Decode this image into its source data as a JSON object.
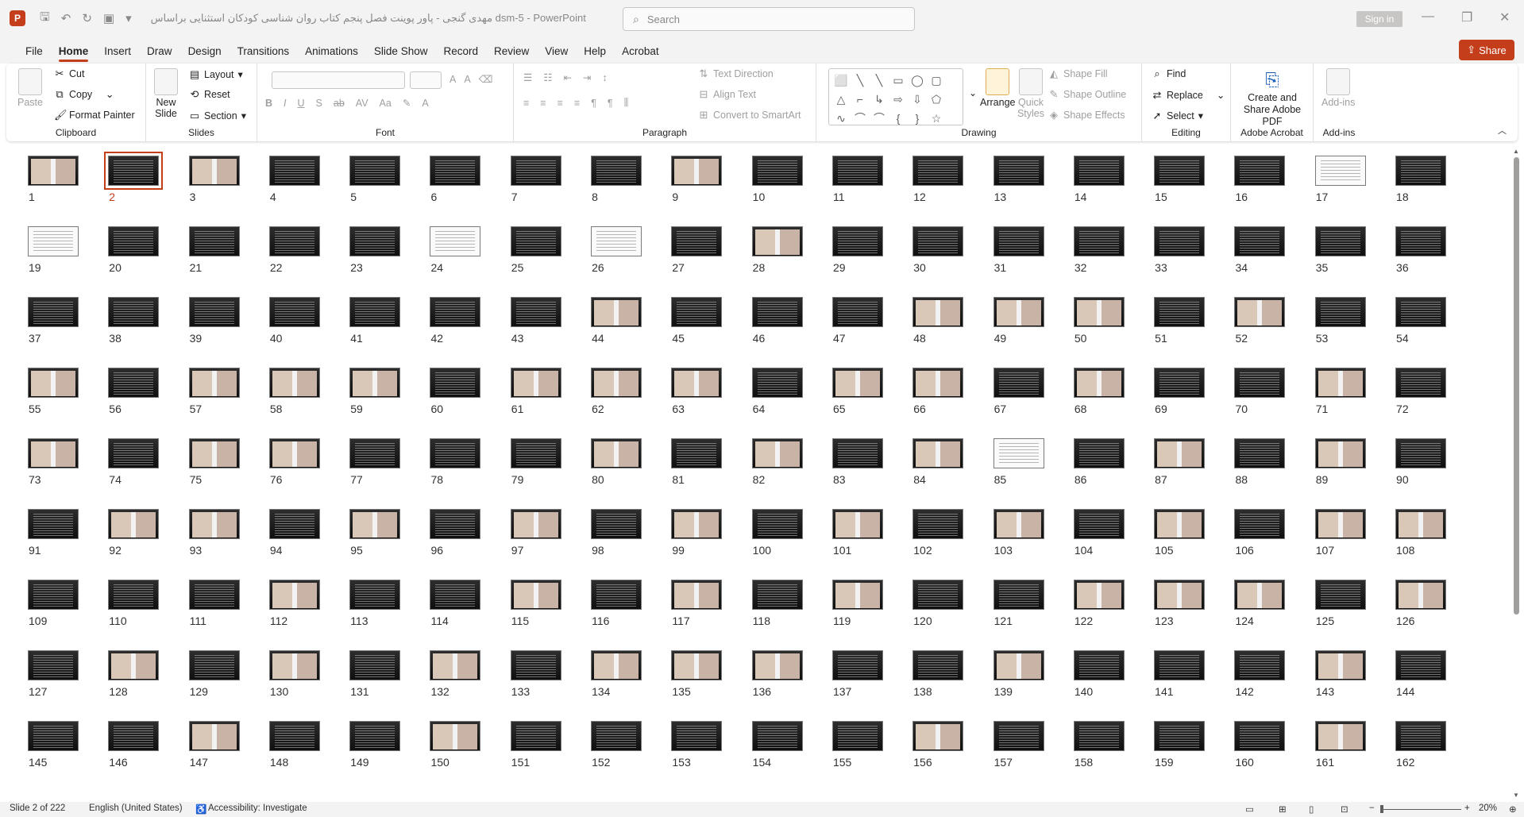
{
  "window": {
    "app_badge": "P",
    "title": "مهدی گنجی - پاور پوینت فصل پنجم کتاب روان شناسی کودکان استثنایی براساس dsm-5 - PowerPoint",
    "search_placeholder": "Search",
    "sign_in": "Sign in",
    "minimize": "—",
    "restore": "❐",
    "close": "✕"
  },
  "quick_access": {
    "save": "💾",
    "undo": "↶",
    "redo": "↷",
    "present": "▣",
    "customize": "⌄"
  },
  "menu": {
    "tabs": [
      "File",
      "Home",
      "Insert",
      "Draw",
      "Design",
      "Transitions",
      "Animations",
      "Slide Show",
      "Record",
      "Review",
      "View",
      "Help",
      "Acrobat"
    ],
    "active": "Home",
    "share": "Share"
  },
  "ribbon": {
    "clipboard": {
      "label": "Clipboard",
      "paste": "Paste",
      "cut": "Cut",
      "copy": "Copy",
      "format_painter": "Format Painter"
    },
    "slides": {
      "label": "Slides",
      "new_slide": "New Slide",
      "layout": "Layout",
      "reset": "Reset",
      "section": "Section"
    },
    "font": {
      "label": "Font",
      "bold": "B",
      "italic": "I",
      "underline": "U",
      "shadow": "S",
      "strike": "ab",
      "grow": "A",
      "shrink": "A"
    },
    "paragraph": {
      "label": "Paragraph",
      "text_direction": "Text Direction",
      "align_text": "Align Text",
      "convert_smartart": "Convert to SmartArt"
    },
    "drawing": {
      "label": "Drawing",
      "arrange": "Arrange",
      "quick_styles": "Quick Styles",
      "shape_fill": "Shape Fill",
      "shape_outline": "Shape Outline",
      "shape_effects": "Shape Effects",
      "shapes": [
        "⬜",
        "╲",
        "╲",
        "▭",
        "◯",
        "▢",
        "△",
        "⌐",
        "↳",
        "⇨",
        "⇩",
        "⬠",
        "∿",
        "⌒",
        "⌒",
        "{",
        "}",
        "☆"
      ]
    },
    "editing": {
      "label": "Editing",
      "find": "Find",
      "replace": "Replace",
      "select": "Select"
    },
    "acrobat": {
      "label": "Adobe Acrobat",
      "create_share": "Create and Share Adobe PDF"
    },
    "addins": {
      "label": "Add-ins",
      "addins_btn": "Add-ins"
    }
  },
  "sorter": {
    "selected_slide": 2,
    "slides": [
      "1",
      "2",
      "3",
      "4",
      "5",
      "6",
      "7",
      "8",
      "9",
      "10",
      "11",
      "12",
      "13",
      "14",
      "15",
      "16",
      "17",
      "18",
      "19",
      "20",
      "21",
      "22",
      "23",
      "24",
      "25",
      "26",
      "27",
      "28",
      "29",
      "30",
      "31",
      "32",
      "33",
      "34",
      "35",
      "36",
      "37",
      "38",
      "39",
      "40",
      "41",
      "42",
      "43",
      "44",
      "45",
      "46",
      "47",
      "48",
      "49",
      "50",
      "51",
      "52",
      "53",
      "54",
      "55",
      "56",
      "57",
      "58",
      "59",
      "60",
      "61",
      "62",
      "63",
      "64",
      "65",
      "66",
      "67",
      "68",
      "69",
      "70",
      "71",
      "72",
      "73",
      "74",
      "75",
      "76",
      "77",
      "78",
      "79",
      "80",
      "81",
      "82",
      "83",
      "84",
      "85",
      "86",
      "87",
      "88",
      "89",
      "90",
      "91",
      "92",
      "93",
      "94",
      "95",
      "96",
      "97",
      "98",
      "99",
      "100",
      "101",
      "102",
      "103",
      "104",
      "105",
      "106",
      "107",
      "108",
      "109",
      "110",
      "111",
      "112",
      "113",
      "114",
      "115",
      "116",
      "117",
      "118",
      "119",
      "120",
      "121",
      "122",
      "123",
      "124",
      "125",
      "126",
      "127",
      "128",
      "129",
      "130",
      "131",
      "132",
      "133",
      "134",
      "135",
      "136",
      "137",
      "138",
      "139",
      "140",
      "141",
      "142",
      "143",
      "144",
      "145",
      "146",
      "147",
      "148",
      "149",
      "150",
      "151",
      "152",
      "153",
      "154",
      "155",
      "156",
      "157",
      "158",
      "159",
      "160",
      "161",
      "162"
    ],
    "image_slides": [
      1,
      3,
      9,
      28,
      44,
      48,
      49,
      50,
      52,
      55,
      57,
      58,
      59,
      61,
      62,
      63,
      65,
      66,
      68,
      71,
      73,
      75,
      76,
      80,
      82,
      84,
      87,
      89,
      92,
      93,
      95,
      97,
      99,
      101,
      103,
      105,
      107,
      108,
      112,
      115,
      117,
      119,
      122,
      123,
      124,
      126,
      128,
      130,
      132,
      134,
      135,
      136,
      139,
      143,
      147,
      150,
      156,
      161
    ],
    "doc_slides": [
      17,
      19,
      24,
      26,
      85
    ]
  },
  "status": {
    "slide_count": "Slide 2 of 222",
    "language": "English (United States)",
    "accessibility": "Accessibility: Investigate",
    "zoom": "20%"
  }
}
